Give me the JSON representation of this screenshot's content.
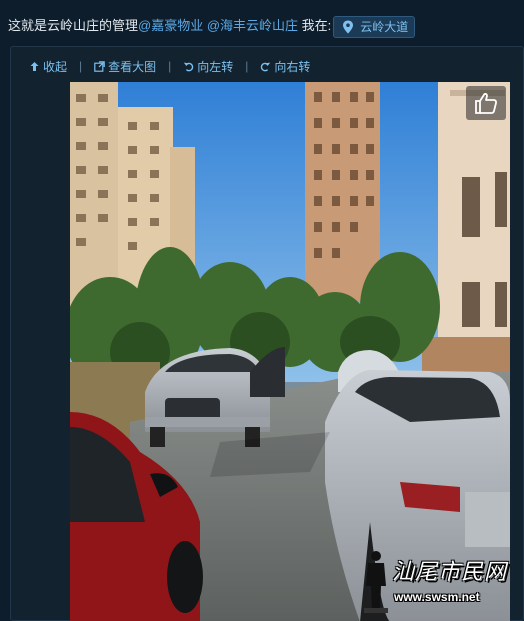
{
  "post": {
    "text_before": "这就是云岭山庄的管理",
    "mention_1": "@嘉豪物业",
    "mention_2": "@海丰云岭山庄",
    "text_after": "我在:",
    "location": "云岭大道"
  },
  "toolbar": {
    "collapse": "收起",
    "view_large": "查看大图",
    "rotate_left": "向左转",
    "rotate_right": "向右转",
    "separator": "|"
  },
  "watermark": {
    "title": "汕尾市民网",
    "url": "www.swsm.net"
  },
  "colors": {
    "background": "#0e1d2b",
    "link": "#5aa9e6",
    "toolbar_link": "#7cc0ef"
  },
  "icons": [
    "collapse-arrow-icon",
    "enlarge-icon",
    "rotate-left-icon",
    "rotate-right-icon",
    "location-pin-icon",
    "thumbs-up-icon"
  ]
}
